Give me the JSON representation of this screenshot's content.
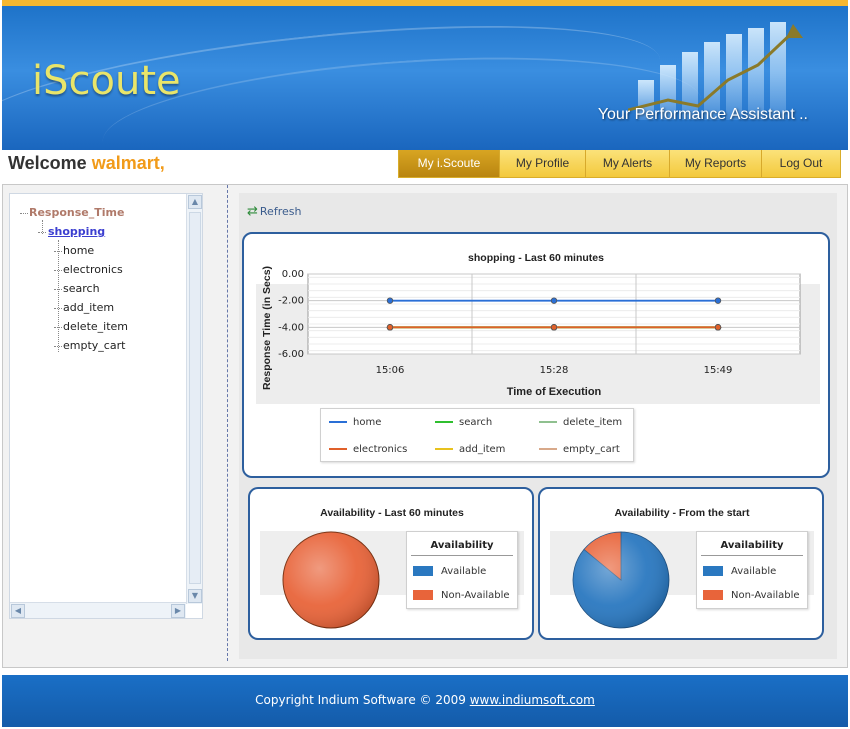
{
  "header": {
    "logo_text": "iScoute",
    "tagline": "Your Performance Assistant .."
  },
  "welcome": {
    "prefix": "Welcome",
    "user": "walmart,"
  },
  "nav": {
    "items": [
      {
        "label": "My i.Scoute",
        "active": true
      },
      {
        "label": "My Profile",
        "active": false
      },
      {
        "label": "My Alerts",
        "active": false
      },
      {
        "label": "My Reports",
        "active": false
      },
      {
        "label": "Log Out",
        "active": false
      }
    ]
  },
  "tree": {
    "root": "Response_Time",
    "group": "shopping",
    "leaves": [
      "home",
      "electronics",
      "search",
      "add_item",
      "delete_item",
      "empty_cart"
    ]
  },
  "toolbar": {
    "refresh_label": "Refresh"
  },
  "colors": {
    "accent": "#f19b1a",
    "card_border": "#2d5f9e",
    "nav_active": "#c8961a"
  },
  "chart_data": [
    {
      "type": "line",
      "title": "shopping - Last 60 minutes",
      "xlabel": "Time of Execution",
      "ylabel": "Response Time (in Secs)",
      "ylim": [
        -6.0,
        0.0
      ],
      "yticks": [
        "0.00",
        "-2.00",
        "-4.00",
        "-6.00"
      ],
      "x": [
        "15:06",
        "15:28",
        "15:49"
      ],
      "grid": true,
      "legend_position": "bottom",
      "series": [
        {
          "name": "home",
          "color": "#2a6fd6",
          "values": [
            -2.0,
            -2.0,
            -2.0
          ]
        },
        {
          "name": "electronics",
          "color": "#e0602a",
          "values": [
            -4.0,
            -4.0,
            -4.0
          ]
        },
        {
          "name": "search",
          "color": "#2fbf2f",
          "values": [
            -4.0,
            -4.0,
            -4.0
          ]
        },
        {
          "name": "add_item",
          "color": "#e8c21e",
          "values": [
            -4.0,
            -4.0,
            -4.0
          ]
        },
        {
          "name": "delete_item",
          "color": "#8fc08f",
          "values": [
            -4.0,
            -4.0,
            -4.0
          ]
        },
        {
          "name": "empty_cart",
          "color": "#d8a98a",
          "values": [
            -4.0,
            -4.0,
            -4.0
          ]
        }
      ]
    },
    {
      "type": "pie",
      "title": "Availability - Last 60 minutes",
      "legend_title": "Availability",
      "categories": [
        "Available",
        "Non-Available"
      ],
      "colors": [
        "#2a78c0",
        "#e8643a"
      ],
      "values": [
        0,
        100
      ]
    },
    {
      "type": "pie",
      "title": "Availability - From the start",
      "legend_title": "Availability",
      "categories": [
        "Available",
        "Non-Available"
      ],
      "colors": [
        "#2a78c0",
        "#e8643a"
      ],
      "values": [
        86,
        14
      ]
    }
  ],
  "footer": {
    "copyright": "Copyright Indium Software © 2009 ",
    "link": "www.indiumsoft.com"
  }
}
